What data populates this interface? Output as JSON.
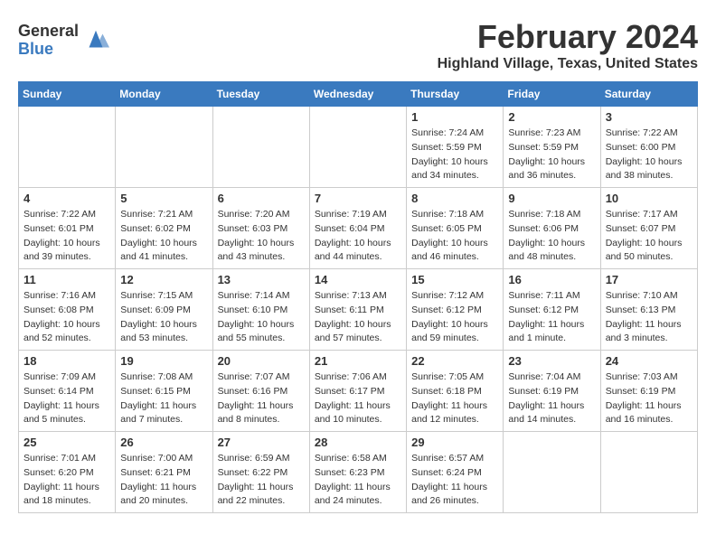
{
  "header": {
    "logo_general": "General",
    "logo_blue": "Blue",
    "month_title": "February 2024",
    "location": "Highland Village, Texas, United States"
  },
  "days_of_week": [
    "Sunday",
    "Monday",
    "Tuesday",
    "Wednesday",
    "Thursday",
    "Friday",
    "Saturday"
  ],
  "weeks": [
    [
      {
        "day": "",
        "info": ""
      },
      {
        "day": "",
        "info": ""
      },
      {
        "day": "",
        "info": ""
      },
      {
        "day": "",
        "info": ""
      },
      {
        "day": "1",
        "info": "Sunrise: 7:24 AM\nSunset: 5:59 PM\nDaylight: 10 hours\nand 34 minutes."
      },
      {
        "day": "2",
        "info": "Sunrise: 7:23 AM\nSunset: 5:59 PM\nDaylight: 10 hours\nand 36 minutes."
      },
      {
        "day": "3",
        "info": "Sunrise: 7:22 AM\nSunset: 6:00 PM\nDaylight: 10 hours\nand 38 minutes."
      }
    ],
    [
      {
        "day": "4",
        "info": "Sunrise: 7:22 AM\nSunset: 6:01 PM\nDaylight: 10 hours\nand 39 minutes."
      },
      {
        "day": "5",
        "info": "Sunrise: 7:21 AM\nSunset: 6:02 PM\nDaylight: 10 hours\nand 41 minutes."
      },
      {
        "day": "6",
        "info": "Sunrise: 7:20 AM\nSunset: 6:03 PM\nDaylight: 10 hours\nand 43 minutes."
      },
      {
        "day": "7",
        "info": "Sunrise: 7:19 AM\nSunset: 6:04 PM\nDaylight: 10 hours\nand 44 minutes."
      },
      {
        "day": "8",
        "info": "Sunrise: 7:18 AM\nSunset: 6:05 PM\nDaylight: 10 hours\nand 46 minutes."
      },
      {
        "day": "9",
        "info": "Sunrise: 7:18 AM\nSunset: 6:06 PM\nDaylight: 10 hours\nand 48 minutes."
      },
      {
        "day": "10",
        "info": "Sunrise: 7:17 AM\nSunset: 6:07 PM\nDaylight: 10 hours\nand 50 minutes."
      }
    ],
    [
      {
        "day": "11",
        "info": "Sunrise: 7:16 AM\nSunset: 6:08 PM\nDaylight: 10 hours\nand 52 minutes."
      },
      {
        "day": "12",
        "info": "Sunrise: 7:15 AM\nSunset: 6:09 PM\nDaylight: 10 hours\nand 53 minutes."
      },
      {
        "day": "13",
        "info": "Sunrise: 7:14 AM\nSunset: 6:10 PM\nDaylight: 10 hours\nand 55 minutes."
      },
      {
        "day": "14",
        "info": "Sunrise: 7:13 AM\nSunset: 6:11 PM\nDaylight: 10 hours\nand 57 minutes."
      },
      {
        "day": "15",
        "info": "Sunrise: 7:12 AM\nSunset: 6:12 PM\nDaylight: 10 hours\nand 59 minutes."
      },
      {
        "day": "16",
        "info": "Sunrise: 7:11 AM\nSunset: 6:12 PM\nDaylight: 11 hours\nand 1 minute."
      },
      {
        "day": "17",
        "info": "Sunrise: 7:10 AM\nSunset: 6:13 PM\nDaylight: 11 hours\nand 3 minutes."
      }
    ],
    [
      {
        "day": "18",
        "info": "Sunrise: 7:09 AM\nSunset: 6:14 PM\nDaylight: 11 hours\nand 5 minutes."
      },
      {
        "day": "19",
        "info": "Sunrise: 7:08 AM\nSunset: 6:15 PM\nDaylight: 11 hours\nand 7 minutes."
      },
      {
        "day": "20",
        "info": "Sunrise: 7:07 AM\nSunset: 6:16 PM\nDaylight: 11 hours\nand 8 minutes."
      },
      {
        "day": "21",
        "info": "Sunrise: 7:06 AM\nSunset: 6:17 PM\nDaylight: 11 hours\nand 10 minutes."
      },
      {
        "day": "22",
        "info": "Sunrise: 7:05 AM\nSunset: 6:18 PM\nDaylight: 11 hours\nand 12 minutes."
      },
      {
        "day": "23",
        "info": "Sunrise: 7:04 AM\nSunset: 6:19 PM\nDaylight: 11 hours\nand 14 minutes."
      },
      {
        "day": "24",
        "info": "Sunrise: 7:03 AM\nSunset: 6:19 PM\nDaylight: 11 hours\nand 16 minutes."
      }
    ],
    [
      {
        "day": "25",
        "info": "Sunrise: 7:01 AM\nSunset: 6:20 PM\nDaylight: 11 hours\nand 18 minutes."
      },
      {
        "day": "26",
        "info": "Sunrise: 7:00 AM\nSunset: 6:21 PM\nDaylight: 11 hours\nand 20 minutes."
      },
      {
        "day": "27",
        "info": "Sunrise: 6:59 AM\nSunset: 6:22 PM\nDaylight: 11 hours\nand 22 minutes."
      },
      {
        "day": "28",
        "info": "Sunrise: 6:58 AM\nSunset: 6:23 PM\nDaylight: 11 hours\nand 24 minutes."
      },
      {
        "day": "29",
        "info": "Sunrise: 6:57 AM\nSunset: 6:24 PM\nDaylight: 11 hours\nand 26 minutes."
      },
      {
        "day": "",
        "info": ""
      },
      {
        "day": "",
        "info": ""
      }
    ]
  ]
}
